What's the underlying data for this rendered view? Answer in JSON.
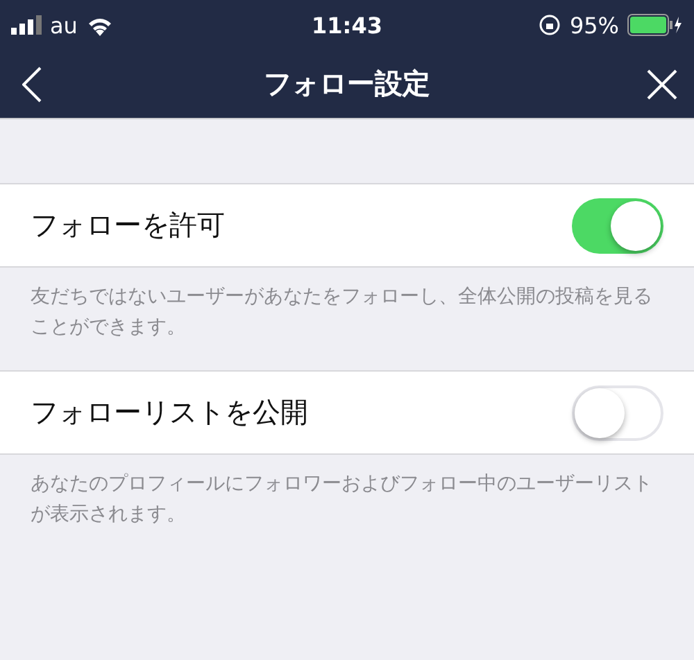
{
  "status_bar": {
    "carrier": "au",
    "time": "11:43",
    "battery": "95%"
  },
  "nav": {
    "title": "フォロー設定"
  },
  "settings": [
    {
      "label": "フォローを許可",
      "on": true,
      "description": "友だちではないユーザーがあなたをフォローし、全体公開の投稿を見ることができます。"
    },
    {
      "label": "フォローリストを公開",
      "on": false,
      "description": "あなたのプロフィールにフォロワーおよびフォロー中のユーザーリストが表示されます。"
    }
  ]
}
